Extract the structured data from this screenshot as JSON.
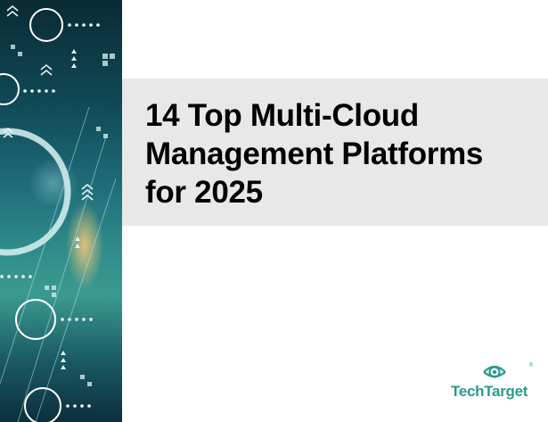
{
  "cover": {
    "title_lines": [
      "14 Top Multi-Cloud",
      "Management Platforms",
      "for 2025"
    ]
  },
  "brand": {
    "logo_text": "TechTarget",
    "registered_mark": "®",
    "accent_color": "#2a9a8e"
  },
  "icons": {
    "logo": "eye-icon",
    "art": "abstract-tech-graphic"
  }
}
